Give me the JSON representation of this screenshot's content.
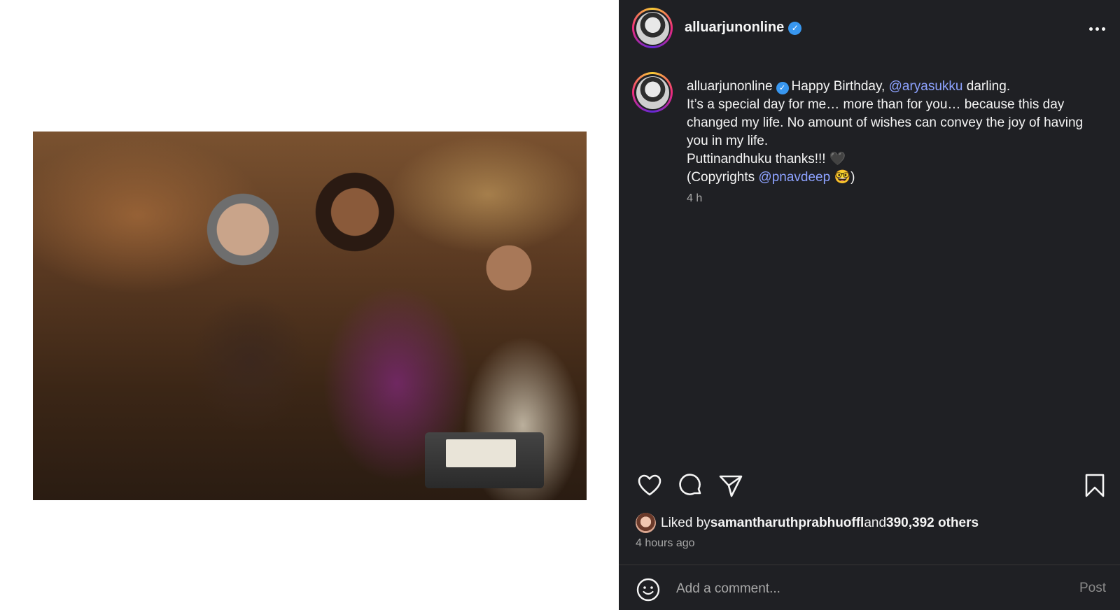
{
  "post": {
    "username": "alluarjunonline",
    "verified_mark": "✓",
    "more_icon": "more-horizontal-icon"
  },
  "caption": {
    "username": "alluarjunonline",
    "text_1": "Happy Birthday, ",
    "mention_1": "@aryasukku",
    "text_2": " darling.",
    "line_2": "It’s a special day for me… more than for you… because this day changed my life. No amount of wishes can convey the joy of having you in my life.",
    "line_3": "Puttinandhuku thanks!!! 🖤",
    "text_3": "(Copyrights ",
    "mention_2": "@pnavdeep",
    "text_4": " 🤓)",
    "time": "4 h"
  },
  "actions": {
    "like_icon": "heart-icon",
    "comment_icon": "comment-bubble-icon",
    "share_icon": "paper-plane-icon",
    "save_icon": "bookmark-icon"
  },
  "likes": {
    "prefix": "Liked by ",
    "liker": "samantharuthprabhuoffl",
    "and": " and ",
    "others": "390,392 others"
  },
  "timestamp": "4 hours ago",
  "comment_box": {
    "placeholder": "Add a comment...",
    "post_label": "Post",
    "emoji_icon": "smiley-icon"
  },
  "colors": {
    "panel_bg": "#1f2024",
    "mention": "#8da2ff",
    "verified": "#3897f0",
    "muted": "#a8a8a8"
  }
}
